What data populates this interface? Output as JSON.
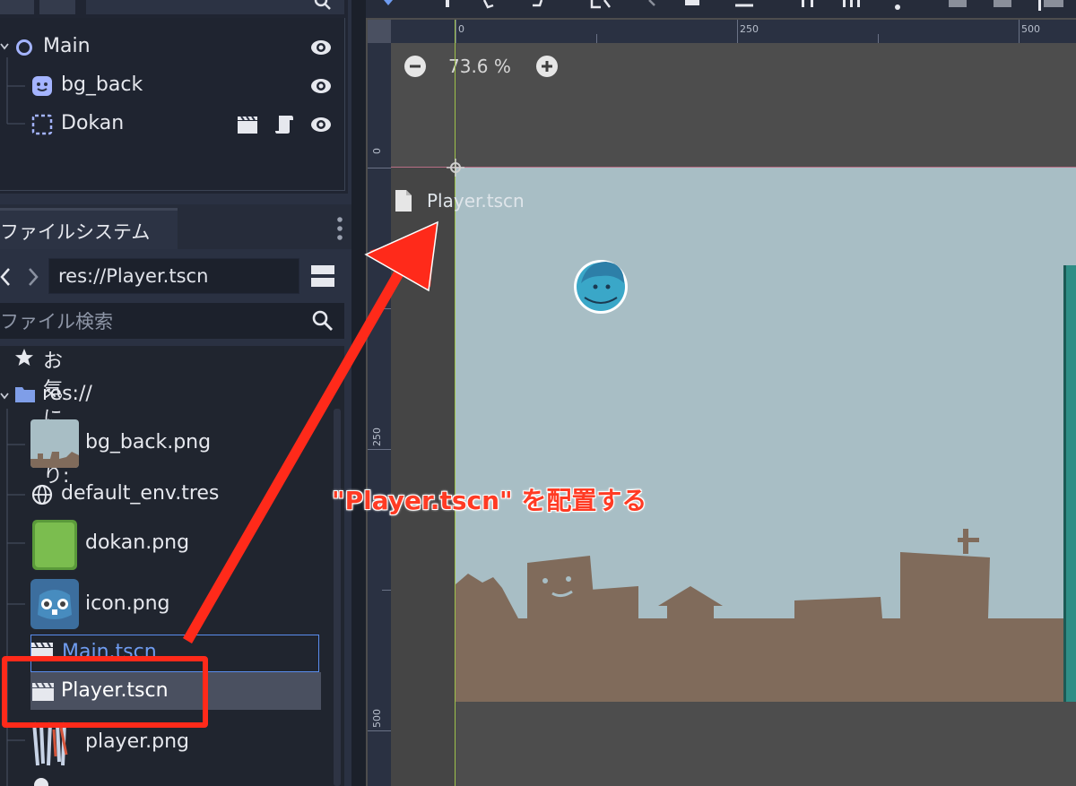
{
  "scene_tree": {
    "tab_label": "ファイルシステム",
    "nodes": [
      {
        "name": "Main",
        "icon": "node2d-circle-icon"
      },
      {
        "name": "bg_back",
        "icon": "sprite-icon"
      },
      {
        "name": "Dokan",
        "icon": "static-body-icon"
      }
    ]
  },
  "filesystem": {
    "tab_label": "ファイルシステム",
    "path": "res://Player.tscn",
    "search_placeholder": "ファイル検索",
    "favorites_label": "お気に入り:",
    "root_label": "res://",
    "files": [
      {
        "name": "bg_back.png"
      },
      {
        "name": "default_env.tres"
      },
      {
        "name": "dokan.png"
      },
      {
        "name": "icon.png"
      },
      {
        "name": "Main.tscn"
      },
      {
        "name": "Player.tscn"
      },
      {
        "name": "player.png"
      }
    ]
  },
  "viewport": {
    "zoom": "73.6 %",
    "ruler_top": [
      "0",
      "250",
      "500"
    ],
    "ruler_left": [
      "0",
      "250",
      "500"
    ],
    "drag_preview_label": "Player.tscn"
  },
  "annotation": {
    "text": "\"Player.tscn\" を配置する",
    "color": "#ff3b24"
  },
  "colors": {
    "accent": "#5a8dee",
    "highlight": "#ff2a1a",
    "sky": "#a8bec5",
    "ground": "#806b5b"
  }
}
